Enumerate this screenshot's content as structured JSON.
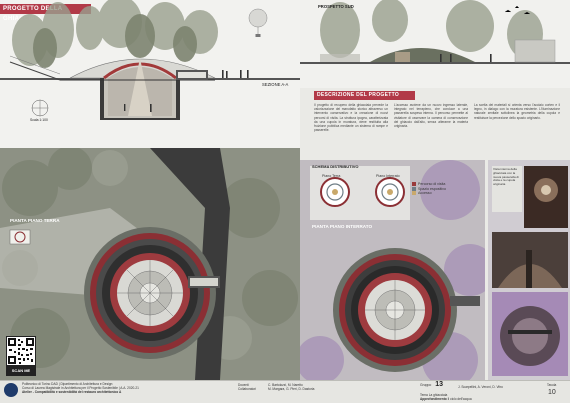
{
  "left": {
    "title": "PROGETTO DELLA GHIACCIAIA",
    "section_label": "SEZIONE A-A",
    "scale_label": "Scala 1:100",
    "plan_label": "PIANTA PIANO TERRA"
  },
  "right": {
    "title_prospetto": "PROSPETTO SUD",
    "title_descrizione": "DESCRIZIONE DEL PROGETTO",
    "body_text_1": "Il progetto di recupero della ghiacciaia prevede la valorizzazione del manufatto storico attraverso un intervento conservativo e la creazione di nuovi percorsi di visita. La struttura ipogea, caratterizzata da una cupola in muratura, viene restituita alla fruizione pubblica mediante un sistema di rampe e passerelle.",
    "body_text_2": "L'accesso avviene da un nuovo ingresso laterale, integrato nel terrapieno, che conduce a una passerella sospesa interna. Il percorso permette al visitatore di osservare la camera di conservazione del ghiaccio dall'alto, senza alterarne la materia originaria.",
    "body_text_3": "La scelta dei materiali si orienta verso l'acciaio corten e il legno, in dialogo con la muratura esistente. L'illuminazione naturale zenitale sottolinea la geometria della cupola e restituisce la percezione dello spazio originario.",
    "schema_title": "SCHEMA DISTRIBUTIVO",
    "schema_sub1": "Piano Terra",
    "schema_sub2": "Piano Interrato",
    "legend": [
      {
        "label": "Percorso di visita",
        "color": "#9a3b3b"
      },
      {
        "label": "Spazio espositivo",
        "color": "#6e7d86"
      },
      {
        "label": "Accesso",
        "color": "#c9a96b"
      }
    ],
    "plan_label": "PIANTA PIANO INTERRATO",
    "render_caption": "Vista interna della ghiacciaia con la nuova passerella di visita e la cupola originaria"
  },
  "qr": {
    "scan_label": "SCAN ME"
  },
  "footer": {
    "line1": "Politecnico di Torino DAD | Dipartimento di Architettura e Design",
    "line2": "Corso di Laurea Magistrale in Architettura per il Progetto Sostenibile | A.A. 2020-21",
    "line3": "Atelier - Compatibilità e sostenibilità del restauro architettonico A",
    "docenti_label": "Docenti",
    "docenti_names": "C. Bartolozzi, M. Naretto",
    "collab_label": "Collaboratori",
    "collab_names": "M. Margara, G. Pieri, D. Dastoria",
    "gruppo_label": "Gruppo",
    "gruppo_num": "13",
    "members": "J. Scarpellini, A. Veroni, D. Vitro",
    "tema_label": "Tema",
    "tema_value": "La ghiacciaia",
    "appro_label": "Approfondimento",
    "appro_value": "Il ciclo dell'acqua",
    "tavola_label": "Tavola",
    "tavola_num": "10"
  }
}
